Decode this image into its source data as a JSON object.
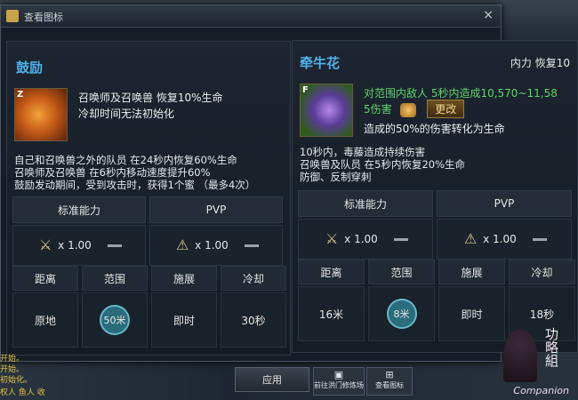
{
  "window": {
    "title": "查看图标",
    "close": "×"
  },
  "left_skill": {
    "name": "鼓励",
    "icon_badge": "Z",
    "effect_line1": "召唤师及召唤兽 恢复10%生命",
    "effect_line2": "冷却时间无法初始化",
    "desc": [
      "自己和召唤兽之外的队员 在24秒内恢复60%生命",
      "召唤师及召唤兽 在6秒内移动速度提升60%",
      "鼓励发动期间，受到攻击时，获得1个蜜 （最多4次）"
    ],
    "tabs": [
      "标准能力",
      "PVP"
    ],
    "mult": [
      "x 1.00",
      "x 1.00"
    ],
    "stat_headers": [
      "距离",
      "范围",
      "施展",
      "冷却"
    ],
    "stat_values": [
      "原地",
      "50米",
      "即时",
      "30秒"
    ]
  },
  "right_skill": {
    "name": "牵牛花",
    "resource": "内力 恢复10",
    "icon_badge": "F",
    "effect_line1": "对范围内敌人 5秒内造成10,570~11,58",
    "effect_line1b": "5伤害",
    "modify_label": "更改",
    "effect_line2": "造成的50%的伤害转化为生命",
    "desc": [
      "10秒内，毒藤造成持续伤害",
      "召唤兽及队员 在5秒内恢复20%生命",
      "防御、反制穿刺"
    ],
    "tabs": [
      "标准能力",
      "PVP"
    ],
    "mult": [
      "x 1.00",
      "x 1.00"
    ],
    "stat_headers": [
      "距离",
      "范围",
      "施展",
      "冷却"
    ],
    "stat_values": [
      "16米",
      "8米",
      "即时",
      "18秒"
    ]
  },
  "bottom": {
    "apply": "应用",
    "btn1": "前往洪门修炼场",
    "btn2": "查看图标"
  },
  "chat": [
    "开始。",
    "开始。",
    "初始化。",
    "权人 鱼人 收"
  ],
  "companion": "Companion",
  "deco": "功略組"
}
